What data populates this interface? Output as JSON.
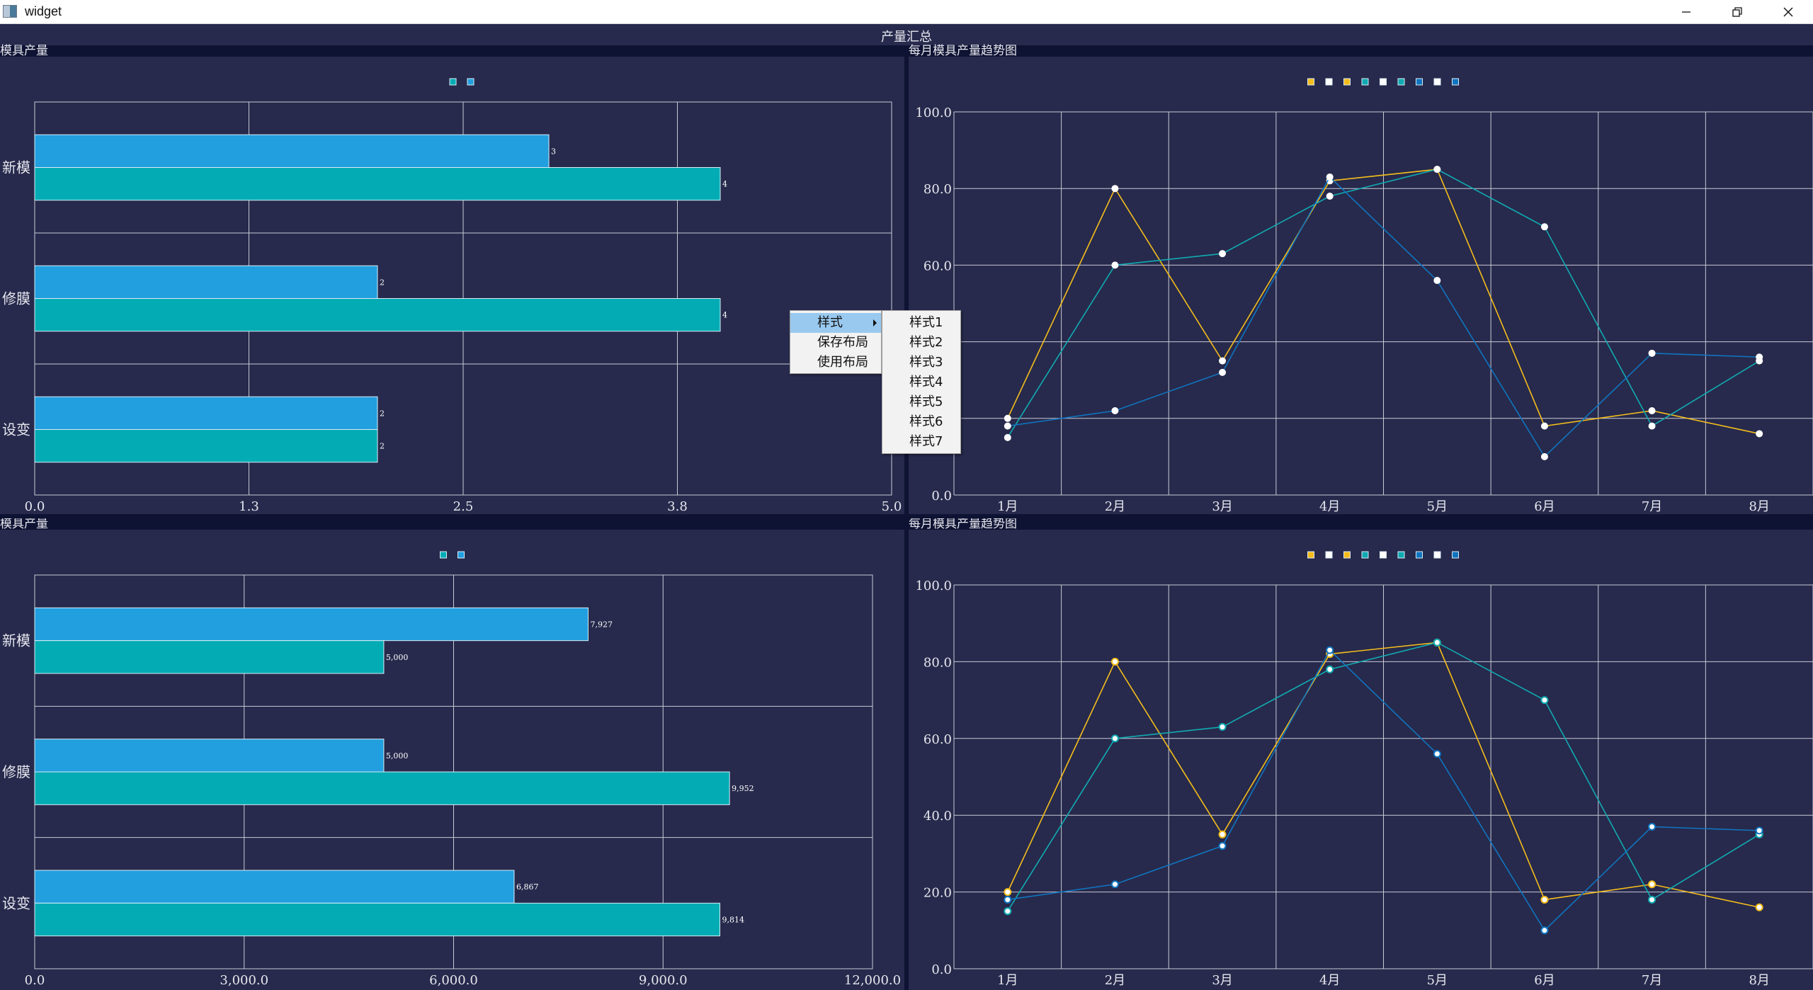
{
  "window": {
    "title": "widget"
  },
  "header": {
    "title": "产量汇总"
  },
  "colors": {
    "bar_blue": "#229fdf",
    "bar_teal": "#03acb4",
    "line_yellow": "#f4bd1c",
    "line_teal": "#11aab2",
    "line_blue": "#1074c0",
    "panel_bg": "#272a4c",
    "strip": "#0f1333"
  },
  "panels": {
    "top_left_title": "模具产量",
    "top_right_title": "每月模具产量趋势图",
    "bottom_left_title": "模具产量",
    "bottom_right_title": "每月模具产量趋势图"
  },
  "context_menu": {
    "items": [
      "样式",
      "保存布局",
      "使用布局"
    ],
    "submenu": [
      "样式1",
      "样式2",
      "样式3",
      "样式4",
      "样式5",
      "样式6",
      "样式7"
    ]
  },
  "chart_data": [
    {
      "type": "bar",
      "orientation": "horizontal",
      "categories": [
        "新模",
        "修膜",
        "设变"
      ],
      "series": [
        {
          "values": [
            3,
            2,
            2
          ],
          "color": "#229fdf"
        },
        {
          "values": [
            4,
            4,
            2
          ],
          "color": "#03acb4"
        }
      ],
      "value_labels": [
        [
          "3",
          "2",
          "2"
        ],
        [
          "4",
          "4",
          "2"
        ]
      ],
      "xticks": [
        "0.0",
        "1.3",
        "2.5",
        "3.8",
        "5.0"
      ],
      "xlim": [
        0,
        5
      ],
      "grid": true
    },
    {
      "type": "line",
      "categories": [
        "1月",
        "2月",
        "3月",
        "4月",
        "5月",
        "6月",
        "7月",
        "8月"
      ],
      "series": [
        {
          "values": [
            20,
            80,
            35,
            82,
            85,
            18,
            22,
            16
          ],
          "color": "#f4bd1c"
        },
        {
          "values": [
            15,
            60,
            63,
            78,
            85,
            70,
            18,
            35
          ],
          "color": "#11aab2"
        },
        {
          "values": [
            18,
            22,
            32,
            83,
            56,
            10,
            37,
            36
          ],
          "color": "#1074c0"
        }
      ],
      "yticks": [
        "0.0",
        "20.0",
        "40.0",
        "60.0",
        "80.0",
        "100.0"
      ],
      "ylim": [
        0,
        100
      ],
      "grid": true,
      "legend": "top-center"
    },
    {
      "type": "bar",
      "orientation": "horizontal",
      "categories": [
        "新模",
        "修膜",
        "设变"
      ],
      "series": [
        {
          "values": [
            7927,
            5000,
            6867
          ],
          "color": "#229fdf"
        },
        {
          "values": [
            5000,
            9952,
            9814
          ],
          "color": "#03acb4"
        }
      ],
      "value_labels": [
        [
          "7,927",
          "5,000",
          "6,867"
        ],
        [
          "5,000",
          "9,952",
          "9,814"
        ]
      ],
      "xticks": [
        "0.0",
        "3,000.0",
        "6,000.0",
        "9,000.0",
        "12,000.0"
      ],
      "xlim": [
        0,
        12000
      ],
      "grid": true
    },
    {
      "type": "line",
      "categories": [
        "1月",
        "2月",
        "3月",
        "4月",
        "5月",
        "6月",
        "7月",
        "8月"
      ],
      "series": [
        {
          "values": [
            20,
            80,
            35,
            82,
            85,
            18,
            22,
            16
          ],
          "color": "#f4bd1c"
        },
        {
          "values": [
            15,
            60,
            63,
            78,
            85,
            70,
            18,
            35
          ],
          "color": "#11aab2"
        },
        {
          "values": [
            18,
            22,
            32,
            83,
            56,
            10,
            37,
            36
          ],
          "color": "#1074c0"
        }
      ],
      "yticks": [
        "0.0",
        "20.0",
        "40.0",
        "60.0",
        "80.0",
        "100.0"
      ],
      "ylim": [
        0,
        100
      ],
      "grid": true,
      "legend": "top-center"
    }
  ]
}
